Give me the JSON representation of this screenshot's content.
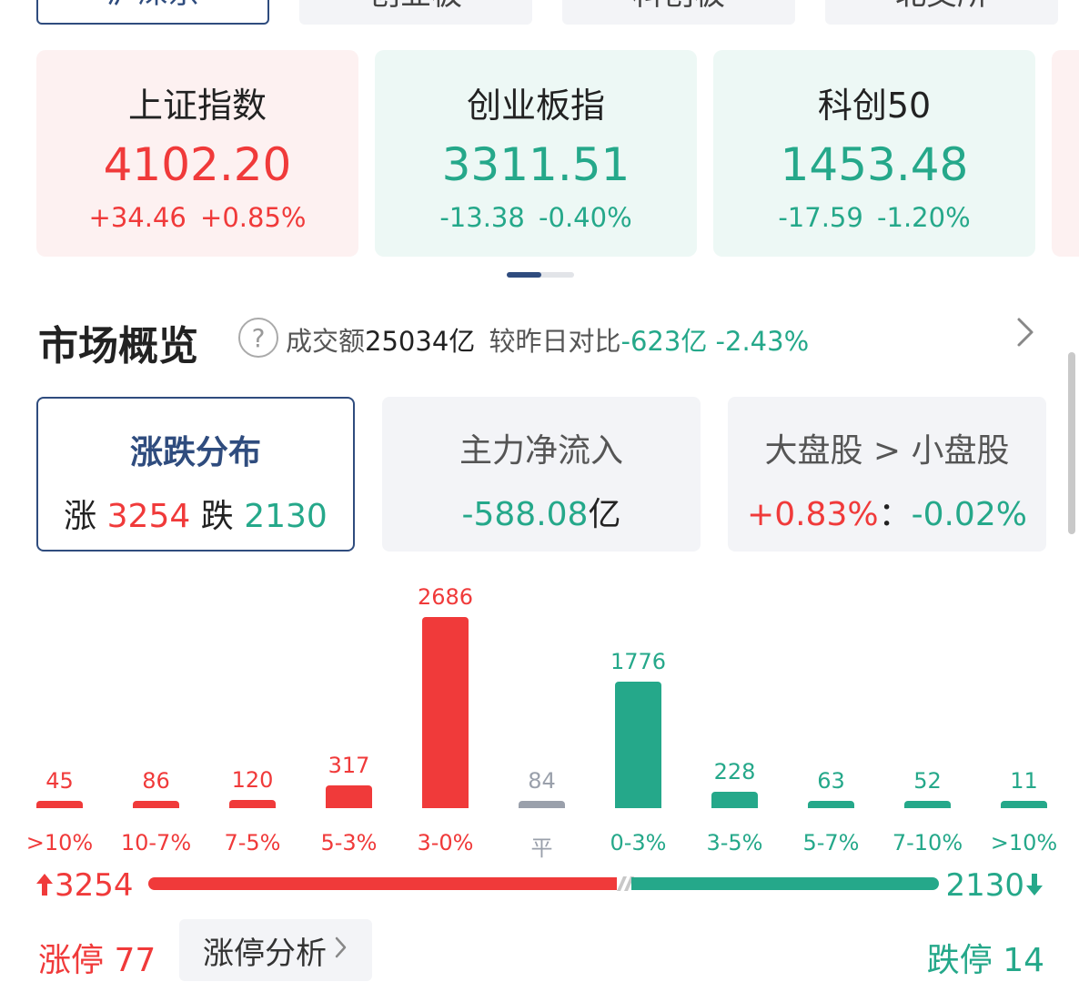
{
  "tabs": [
    {
      "label": "沪深京",
      "active": true
    },
    {
      "label": "创业板",
      "active": false
    },
    {
      "label": "科创板",
      "active": false
    },
    {
      "label": "北交所",
      "active": false
    }
  ],
  "indices": [
    {
      "name": "上证指数",
      "value": "4102.20",
      "change": "+34.46 +0.85%",
      "trend": "up"
    },
    {
      "name": "创业板指",
      "value": "3311.51",
      "change": "-13.38 -0.40%",
      "trend": "down"
    },
    {
      "name": "科创50",
      "value": "1453.48",
      "change": "-17.59 -1.20%",
      "trend": "down"
    }
  ],
  "overview": {
    "title": "市场概览",
    "help_icon": "?",
    "turnover_label": "成交额",
    "turnover_value": "25034亿",
    "compare_label": "较昨日对比",
    "compare_value": "-623亿 -2.43%"
  },
  "stats": {
    "dist": {
      "title": "涨跌分布",
      "up_label": "涨",
      "up_count": "3254",
      "down_label": "跌",
      "down_count": "2130"
    },
    "flow": {
      "title": "主力净流入",
      "value": "-588.08",
      "unit": "亿"
    },
    "cap": {
      "title": "大盘股 > 小盘股",
      "large": "+0.83%",
      "sep": "：",
      "small": "-0.02%"
    }
  },
  "chart_data": {
    "type": "bar",
    "categories": [
      ">10%",
      "10-7%",
      "7-5%",
      "5-3%",
      "3-0%",
      "平",
      "0-3%",
      "3-5%",
      "5-7%",
      "7-10%",
      ">10%"
    ],
    "values": [
      45,
      86,
      120,
      317,
      2686,
      84,
      1776,
      228,
      63,
      52,
      11
    ],
    "colors": [
      "#f03a3a",
      "#f03a3a",
      "#f03a3a",
      "#f03a3a",
      "#f03a3a",
      "#9aa0ab",
      "#25a88a",
      "#25a88a",
      "#25a88a",
      "#25a88a",
      "#25a88a"
    ]
  },
  "ratio": {
    "up": "3254",
    "down": "2130"
  },
  "limits": {
    "up_label": "涨停",
    "up_count": "77",
    "analyze_label": "涨停分析",
    "down_label": "跌停",
    "down_count": "14"
  },
  "colors": {
    "up": "#f03a3a",
    "down": "#25a88a",
    "flat": "#9aa0ab",
    "accent": "#2f4c7e"
  }
}
